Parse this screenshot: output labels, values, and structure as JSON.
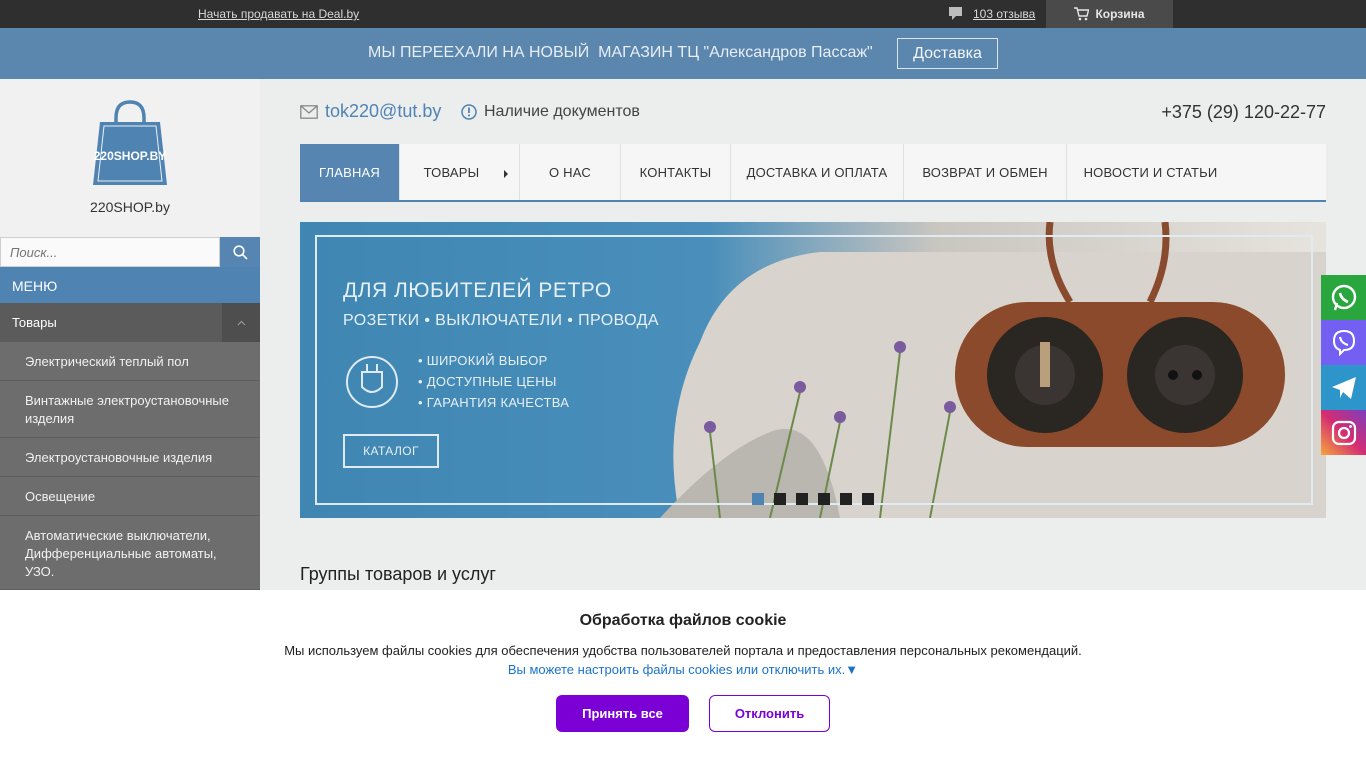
{
  "topbar": {
    "sell_link": "Начать продавать на Deal.by",
    "reviews": "103 отзыва",
    "cart": "Корзина"
  },
  "announce": {
    "message": "МЫ ПЕРЕЕХАЛИ НА НОВЫЙ  МАГАЗИН ТЦ \"Александров Пассаж\"",
    "button": "Доставка"
  },
  "sidebar": {
    "logo_text": "220SHOP.BY",
    "site_name": "220SHOP.by",
    "search_placeholder": "Поиск...",
    "menu_title": "МЕНЮ",
    "goods_label": "Товары",
    "items": [
      "Электрический теплый пол",
      "Винтажные электроустановочные изделия",
      "Электроустановочные изделия",
      "Освещение",
      "Автоматические выключатели, Дифференциальные автоматы, УЗО."
    ]
  },
  "contact": {
    "email": "tok220@tut.by",
    "docs": "Наличие документов",
    "phone": "+375 (29) 120-22-77"
  },
  "nav": [
    "ГЛАВНАЯ",
    "ТОВАРЫ",
    "О НАС",
    "КОНТАКТЫ",
    "ДОСТАВКА И ОПЛАТА",
    "ВОЗВРАТ И ОБМЕН",
    "НОВОСТИ И СТАТЬИ"
  ],
  "banner": {
    "title": "ДЛЯ ЛЮБИТЕЛЕЙ РЕТРО",
    "subtitle": "РОЗЕТКИ • ВЫКЛЮЧАТЕЛИ • ПРОВОДА",
    "features": [
      "• ШИРОКИЙ ВЫБОР",
      "• ДОСТУПНЫЕ ЦЕНЫ",
      "• ГАРАНТИЯ КАЧЕСТВА"
    ],
    "catalog": "КАТАЛОГ",
    "active_slide": 1,
    "slide_count": 6
  },
  "section_title": "Группы товаров и услуг",
  "social": [
    "whatsapp-icon",
    "viber-icon",
    "telegram-icon",
    "instagram-icon"
  ],
  "cookie": {
    "title": "Обработка файлов cookie",
    "text": "Мы используем файлы cookies для обеспечения удобства пользователей портала и предоставления персональных рекомендаций.",
    "link": "Вы можете настроить файлы cookies или отключить их.▼",
    "accept": "Принять все",
    "decline": "Отклонить"
  },
  "colors": {
    "brand_blue": "#4f83b2",
    "announce_bg": "#5b86ad",
    "accept_purple": "#7a00d6",
    "topbar_bg": "#2f2f2f"
  }
}
